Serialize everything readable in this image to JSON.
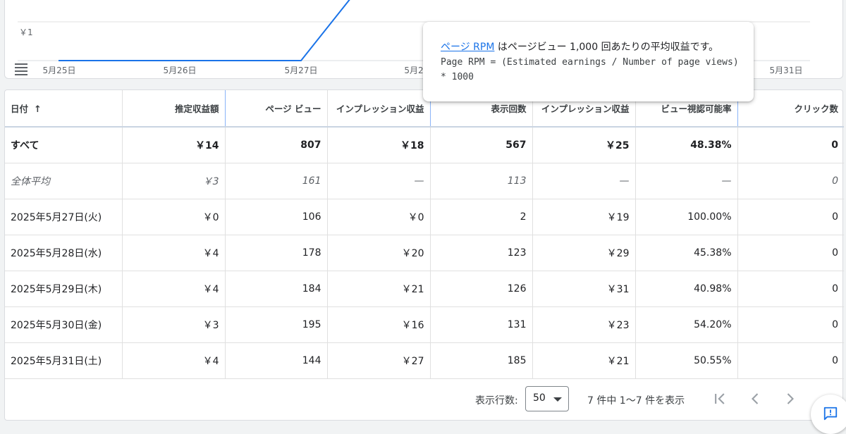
{
  "chart": {
    "y_tick_label": "￥1",
    "x_labels": [
      "5月25日",
      "5月26日",
      "5月27日",
      "5月2",
      "5月31日"
    ],
    "line_color": "#1a73e8"
  },
  "tooltip": {
    "link_text": "ページ RPM",
    "line1_rest": " はページビュー 1,000 回あたりの平均収益です。",
    "formula_line1": "Page RPM = (Estimated earnings / Number of page views)",
    "formula_line2": "* 1000"
  },
  "table": {
    "headers": [
      "日付",
      "推定収益額",
      "ページ ビュー",
      "インプレッション収益",
      "表示回数",
      "インプレッション収益",
      "ビュー視認可能率",
      "クリック数"
    ],
    "sort_arrow": "↑",
    "total_row": [
      "すべて",
      "￥14",
      "807",
      "￥18",
      "567",
      "￥25",
      "48.38%",
      "0"
    ],
    "avg_row": [
      "全体平均",
      "￥3",
      "161",
      "—",
      "113",
      "—",
      "—",
      "0"
    ],
    "rows": [
      [
        "2025年5月27日(火)",
        "￥0",
        "106",
        "￥0",
        "2",
        "￥19",
        "100.00%",
        "0"
      ],
      [
        "2025年5月28日(水)",
        "￥4",
        "178",
        "￥20",
        "123",
        "￥29",
        "45.38%",
        "0"
      ],
      [
        "2025年5月29日(木)",
        "￥4",
        "184",
        "￥21",
        "126",
        "￥31",
        "40.98%",
        "0"
      ],
      [
        "2025年5月30日(金)",
        "￥3",
        "195",
        "￥16",
        "131",
        "￥23",
        "54.20%",
        "0"
      ],
      [
        "2025年5月31日(土)",
        "￥4",
        "144",
        "￥27",
        "185",
        "￥21",
        "50.55%",
        "0"
      ]
    ]
  },
  "footer": {
    "rows_label": "表示行数:",
    "rows_value": "50",
    "range_text": "7 件中 1〜7 件を表示"
  }
}
